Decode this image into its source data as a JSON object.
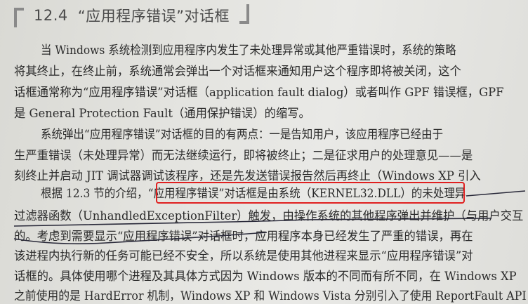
{
  "heading": {
    "number": "12.4",
    "title": "“应用程序错误”对话框"
  },
  "paragraphs": [
    {
      "lines": [
        "当 Windows 系统检测到应用程序内发生了未处理异常或其他严重错误时，系统的策略",
        "将其终止，在终止前，系统通常会弹出一个对话框来通知用户这个程序即将被关闭，这个",
        "话框通常称为“应用程序错误”对话框（application fault dialog）或者叫作 GPF 错误框，GPF",
        "是 General Protection Fault（通用保护错误）的缩写。"
      ]
    },
    {
      "lines": [
        "系统弹出“应用程序错误”对话框的目的有两点：一是告知用户，该应用程序已经由于",
        "生严重错误（未处理异常）而无法继续运行，即将被终止；二是征求用户的处理意见——是",
        "刻终止并启动 JIT 调试器调试该程序，还是先发送错误报告然后再终止（Windows XP 引入"
      ]
    },
    {
      "lines": [
        "根据 12.3 节的介绍，“应用程序错误”对话框是由系统（KERNEL32.DLL）的未处理异",
        "过滤器函数（UnhandledExceptionFilter）触发，由操作系统的其他程序弹出并维护（与用户交互",
        "的。考虑到需要显示“应用程序错误”对话框时，应用程序本身已经发生了严重的错误，再在",
        "该进程内执行新的任务可能已经不安全，所以系统是使用其他进程来显示“应用程序错误”对",
        "话框的。具体使用哪个进程及其具体方式因为 Windows 版本的不同而有所不同，在 Windows XP",
        "之前使用的是 HardError 机制，Windows XP 和 Windows Vista 分别引入了使用 ReportFault API"
      ]
    }
  ]
}
